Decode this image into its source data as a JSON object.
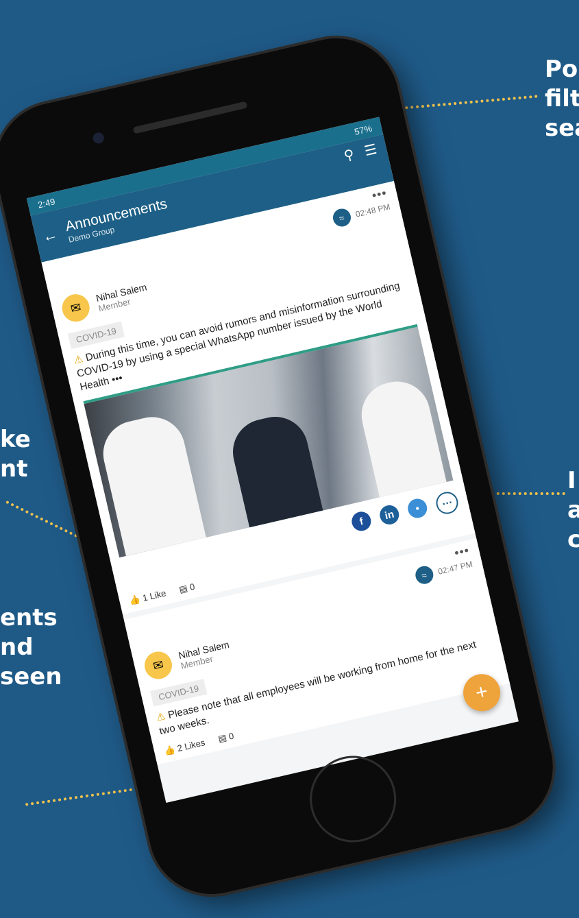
{
  "status": {
    "time": "2:49",
    "battery": "57%"
  },
  "appbar": {
    "back_icon": "arrow-left",
    "title": "Announcements",
    "subtitle": "Demo Group"
  },
  "posts": [
    {
      "time": "02:48 PM",
      "author": "Nihal Salem",
      "role": "Member",
      "tag": "COVID-19",
      "text": "During this time, you can avoid rumors and misinformation surrounding COVID-19 by using a special WhatsApp number issued by the World Health",
      "likes": "1 Like",
      "comments": "0"
    },
    {
      "time": "02:47 PM",
      "author": "Nihal Salem",
      "role": "Member",
      "tag": "COVID-19",
      "text": "Please note that all employees will be working from home for the next two weeks.",
      "likes": "2 Likes",
      "comments": "0"
    }
  ],
  "callouts": {
    "top_right": [
      "Po",
      "filt",
      "sea"
    ],
    "left_mid": [
      "ke",
      "nt"
    ],
    "right_mid": [
      "I",
      "a",
      "c"
    ],
    "left_bottom": [
      "ents",
      "nd",
      "seen"
    ]
  },
  "colors": {
    "background": "#1f5a87",
    "appbar": "#1d5f86",
    "dots": "#f0c24b",
    "fab": "#efa33b"
  }
}
